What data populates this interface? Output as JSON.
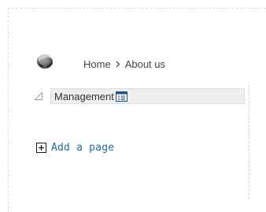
{
  "breadcrumb": {
    "home_label": "Home",
    "separator": "chevron-right-icon",
    "current_label": "About us"
  },
  "logo": {
    "icon": "site-gear-logo-icon"
  },
  "navigation_section": {
    "collapse_icon": "triangle-collapse-icon",
    "title": "Management",
    "menu_icon": "edit-menu-icon"
  },
  "actions": {
    "add_page_icon": "plus-box-icon",
    "add_page_label": "Add a page"
  },
  "colors": {
    "link": "#1a6eb0",
    "text": "#444444",
    "section_bg": "#efefef",
    "dashed_border": "#cfdfe9"
  }
}
